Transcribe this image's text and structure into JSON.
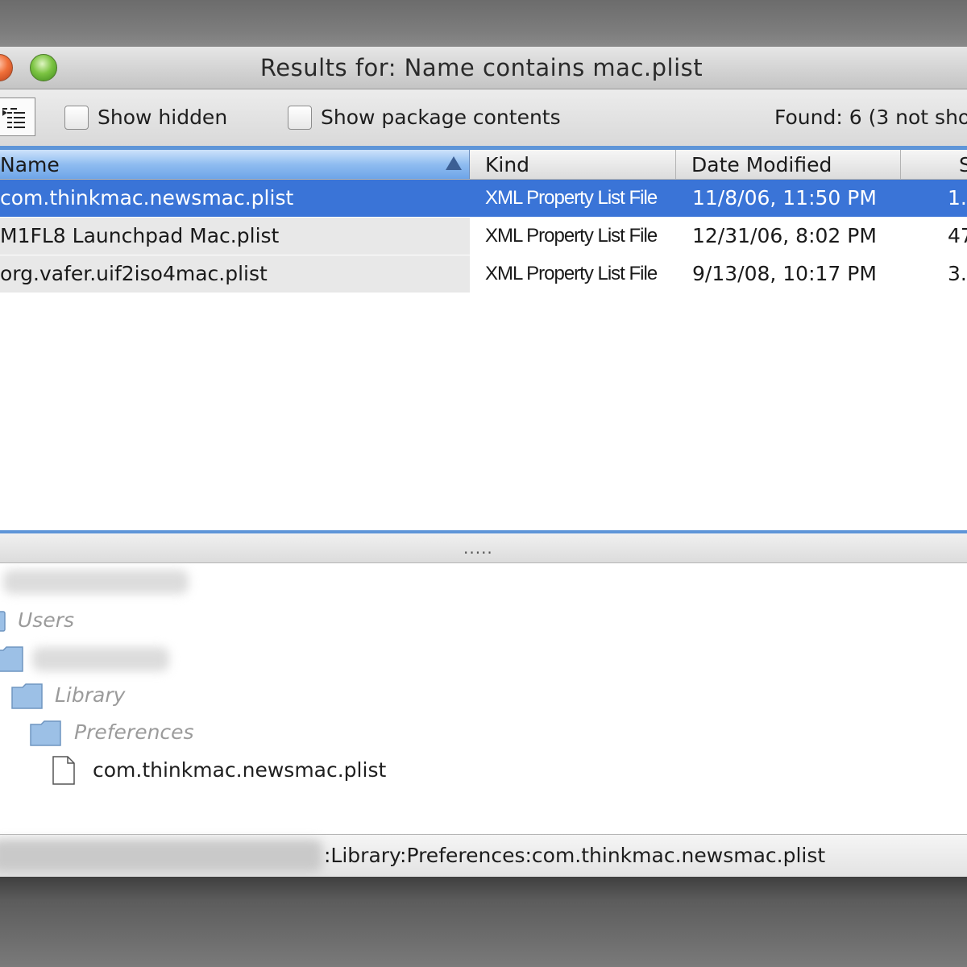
{
  "window": {
    "title": "Results for: Name contains mac.plist"
  },
  "toolbar": {
    "view_icon": "outline-view-icon",
    "show_hidden_label": "Show hidden",
    "show_hidden_checked": false,
    "show_package_contents_label": "Show package contents",
    "show_package_contents_checked": false,
    "found_text": "Found: 6 (3 not sho"
  },
  "table": {
    "columns": [
      "Name",
      "Kind",
      "Date Modified",
      "S"
    ],
    "sort_column": "Name",
    "sort_direction": "ascending",
    "rows": [
      {
        "name": "com.thinkmac.newsmac.plist",
        "kind": "XML Property List File",
        "date": "11/8/06, 11:50 PM",
        "size": "1.",
        "selected": true
      },
      {
        "name": "M1FL8 Launchpad Mac.plist",
        "kind": "XML Property List File",
        "date": "12/31/06, 8:02 PM",
        "size": "47",
        "selected": false
      },
      {
        "name": "org.vafer.uif2iso4mac.plist",
        "kind": "XML Property List File",
        "date": "9/13/08, 10:17 PM",
        "size": "3.",
        "selected": false
      }
    ]
  },
  "splitter": {
    "grip": "....."
  },
  "path_tree": {
    "items": [
      {
        "label": "Users",
        "icon": "folder-icon"
      },
      {
        "label": "Library",
        "icon": "folder-icon"
      },
      {
        "label": "Preferences",
        "icon": "folder-icon"
      },
      {
        "label": "com.thinkmac.newsmac.plist",
        "icon": "document-icon"
      }
    ]
  },
  "status": {
    "path_text": ":Library:Preferences:com.thinkmac.newsmac.plist"
  },
  "colors": {
    "selection": "#3a74d7",
    "accent_line": "#5e95d8",
    "header_sorted": "#8fbcf0"
  }
}
